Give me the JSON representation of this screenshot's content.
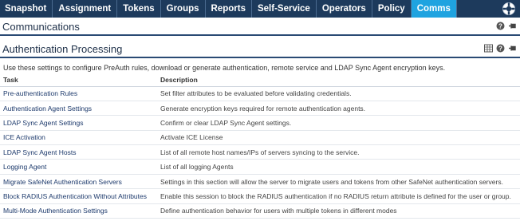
{
  "nav": {
    "items": [
      {
        "label": "Snapshot",
        "active": false
      },
      {
        "label": "Assignment",
        "active": false
      },
      {
        "label": "Tokens",
        "active": false
      },
      {
        "label": "Groups",
        "active": false
      },
      {
        "label": "Reports",
        "active": false
      },
      {
        "label": "Self-Service",
        "active": false
      },
      {
        "label": "Operators",
        "active": false
      },
      {
        "label": "Policy",
        "active": false
      },
      {
        "label": "Comms",
        "active": true
      }
    ],
    "help_icon": "lifebuoy-icon"
  },
  "communications": {
    "title": "Communications"
  },
  "auth_processing": {
    "title": "Authentication Processing",
    "intro": "Use these settings to configure PreAuth rules, download or generate authentication, remote service and LDAP Sync Agent encryption keys.",
    "columns": [
      "Task",
      "Description"
    ],
    "rows": [
      {
        "task": "Pre-authentication Rules",
        "description": "Set filter attributes to be evaluated before validating credentials."
      },
      {
        "task": "Authentication Agent Settings",
        "description": "Generate encryption keys required for remote authentication agents."
      },
      {
        "task": "LDAP Sync Agent Settings",
        "description": "Confirm or clear LDAP Sync Agent settings."
      },
      {
        "task": "ICE Activation",
        "description": "Activate ICE License"
      },
      {
        "task": "LDAP Sync Agent Hosts",
        "description": "List of all remote host names/IPs of servers syncing to the service."
      },
      {
        "task": "Logging Agent",
        "description": "List of all logging Agents"
      },
      {
        "task": "Migrate SafeNet Authentication Servers",
        "description": "Settings in this section will allow the server to migrate users and tokens from other SafeNet authentication servers."
      },
      {
        "task": "Block RADIUS Authentication Without Attributes",
        "description": "Enable this session to block the RADIUS authentication if no RADIUS return attribute is defined for the user or group."
      },
      {
        "task": "Multi-Mode Authentication Settings",
        "description": "Define authentication behavior for users with multiple tokens in different modes"
      }
    ]
  },
  "colors": {
    "nav_bg": "#1d3a5c",
    "nav_active": "#1fa3e0",
    "link": "#1d3a6c"
  }
}
